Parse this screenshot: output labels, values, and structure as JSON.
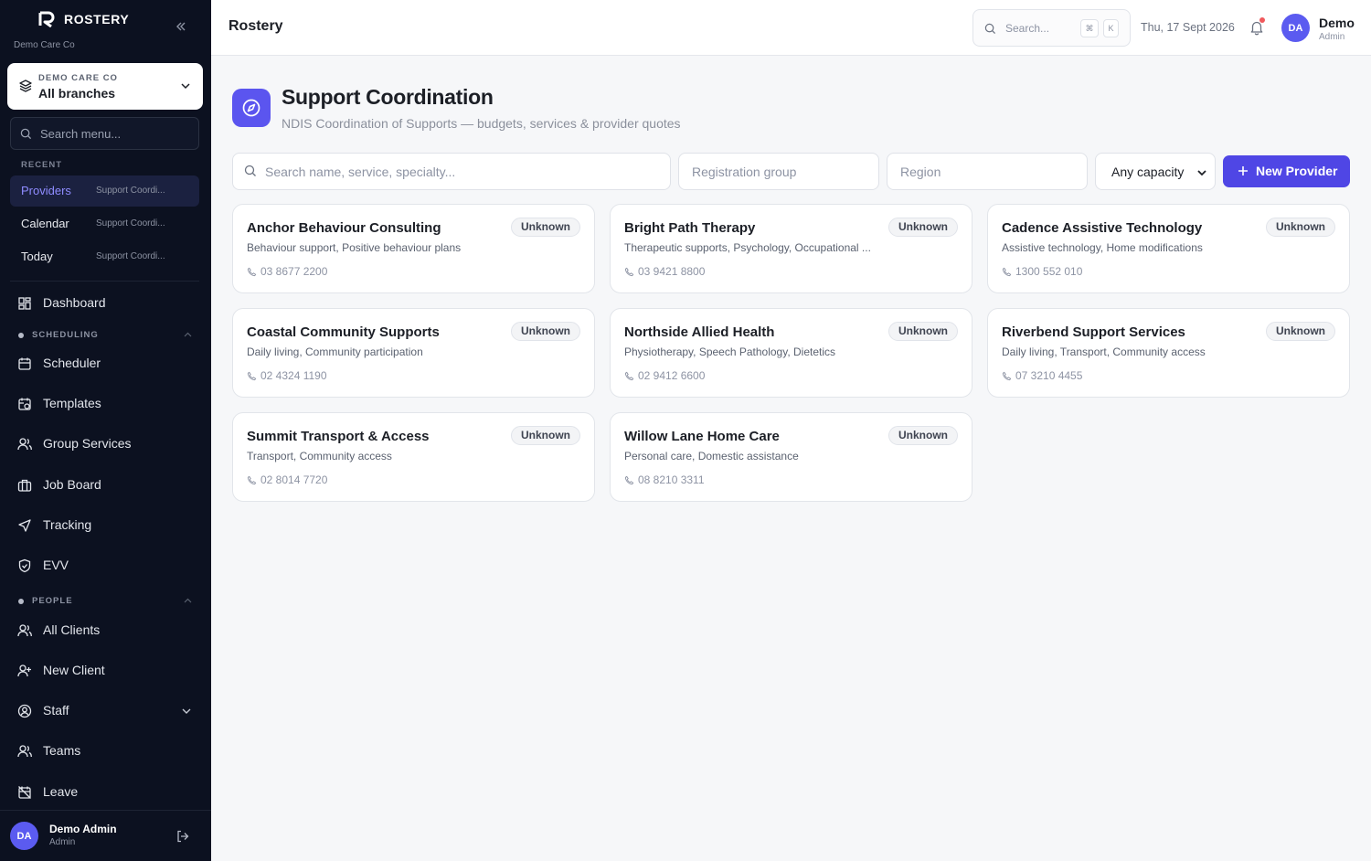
{
  "app": {
    "brand": "ROSTERY",
    "org_name": "Demo Care Co",
    "page_title": "Rostery"
  },
  "sidebar": {
    "branch": {
      "org": "DEMO CARE CO",
      "name": "All branches"
    },
    "search_placeholder": "Search menu...",
    "recent_label": "RECENT",
    "recent": [
      {
        "label": "Providers",
        "sub": "Support Coordi..."
      },
      {
        "label": "Calendar",
        "sub": "Support Coordi..."
      },
      {
        "label": "Today",
        "sub": "Support Coordi..."
      }
    ],
    "dashboard": "Dashboard",
    "scheduling_label": "SCHEDULING",
    "scheduling": [
      "Scheduler",
      "Templates",
      "Group Services",
      "Job Board",
      "Tracking",
      "EVV"
    ],
    "people_label": "PEOPLE",
    "people": [
      "All Clients",
      "New Client",
      "Staff",
      "Teams",
      "Leave"
    ],
    "user": {
      "name": "Demo Admin",
      "role": "Admin",
      "initials": "DA"
    }
  },
  "topbar": {
    "search_placeholder": "Search...",
    "kbd_cmd": "⌘",
    "kbd_k": "K",
    "date": "Thu, 17 Sept 2026",
    "user": {
      "name": "Demo",
      "role": "Admin",
      "initials": "DA"
    }
  },
  "main": {
    "title": "Support Coordination",
    "subtitle": "NDIS Coordination of Supports — budgets, services & provider quotes",
    "filters": {
      "search_placeholder": "Search name, service, specialty...",
      "registration_placeholder": "Registration group",
      "region_placeholder": "Region",
      "capacity": "Any capacity"
    },
    "new_button": "New Provider",
    "providers": [
      {
        "name": "Anchor Behaviour Consulting",
        "badge": "Unknown",
        "services": "Behaviour support, Positive behaviour plans",
        "phone": "03 8677 2200"
      },
      {
        "name": "Bright Path Therapy",
        "badge": "Unknown",
        "services": "Therapeutic supports, Psychology, Occupational ...",
        "phone": "03 9421 8800"
      },
      {
        "name": "Cadence Assistive Technology",
        "badge": "Unknown",
        "services": "Assistive technology, Home modifications",
        "phone": "1300 552 010"
      },
      {
        "name": "Coastal Community Supports",
        "badge": "Unknown",
        "services": "Daily living, Community participation",
        "phone": "02 4324 1190"
      },
      {
        "name": "Northside Allied Health",
        "badge": "Unknown",
        "services": "Physiotherapy, Speech Pathology, Dietetics",
        "phone": "02 9412 6600"
      },
      {
        "name": "Riverbend Support Services",
        "badge": "Unknown",
        "services": "Daily living, Transport, Community access",
        "phone": "07 3210 4455"
      },
      {
        "name": "Summit Transport & Access",
        "badge": "Unknown",
        "services": "Transport, Community access",
        "phone": "02 8014 7720"
      },
      {
        "name": "Willow Lane Home Care",
        "badge": "Unknown",
        "services": "Personal care, Domestic assistance",
        "phone": "08 8210 3311"
      }
    ]
  },
  "colors": {
    "accent": "#4f46e5",
    "sidebar_bg": "#0c1120",
    "notification": "#f0595c"
  }
}
